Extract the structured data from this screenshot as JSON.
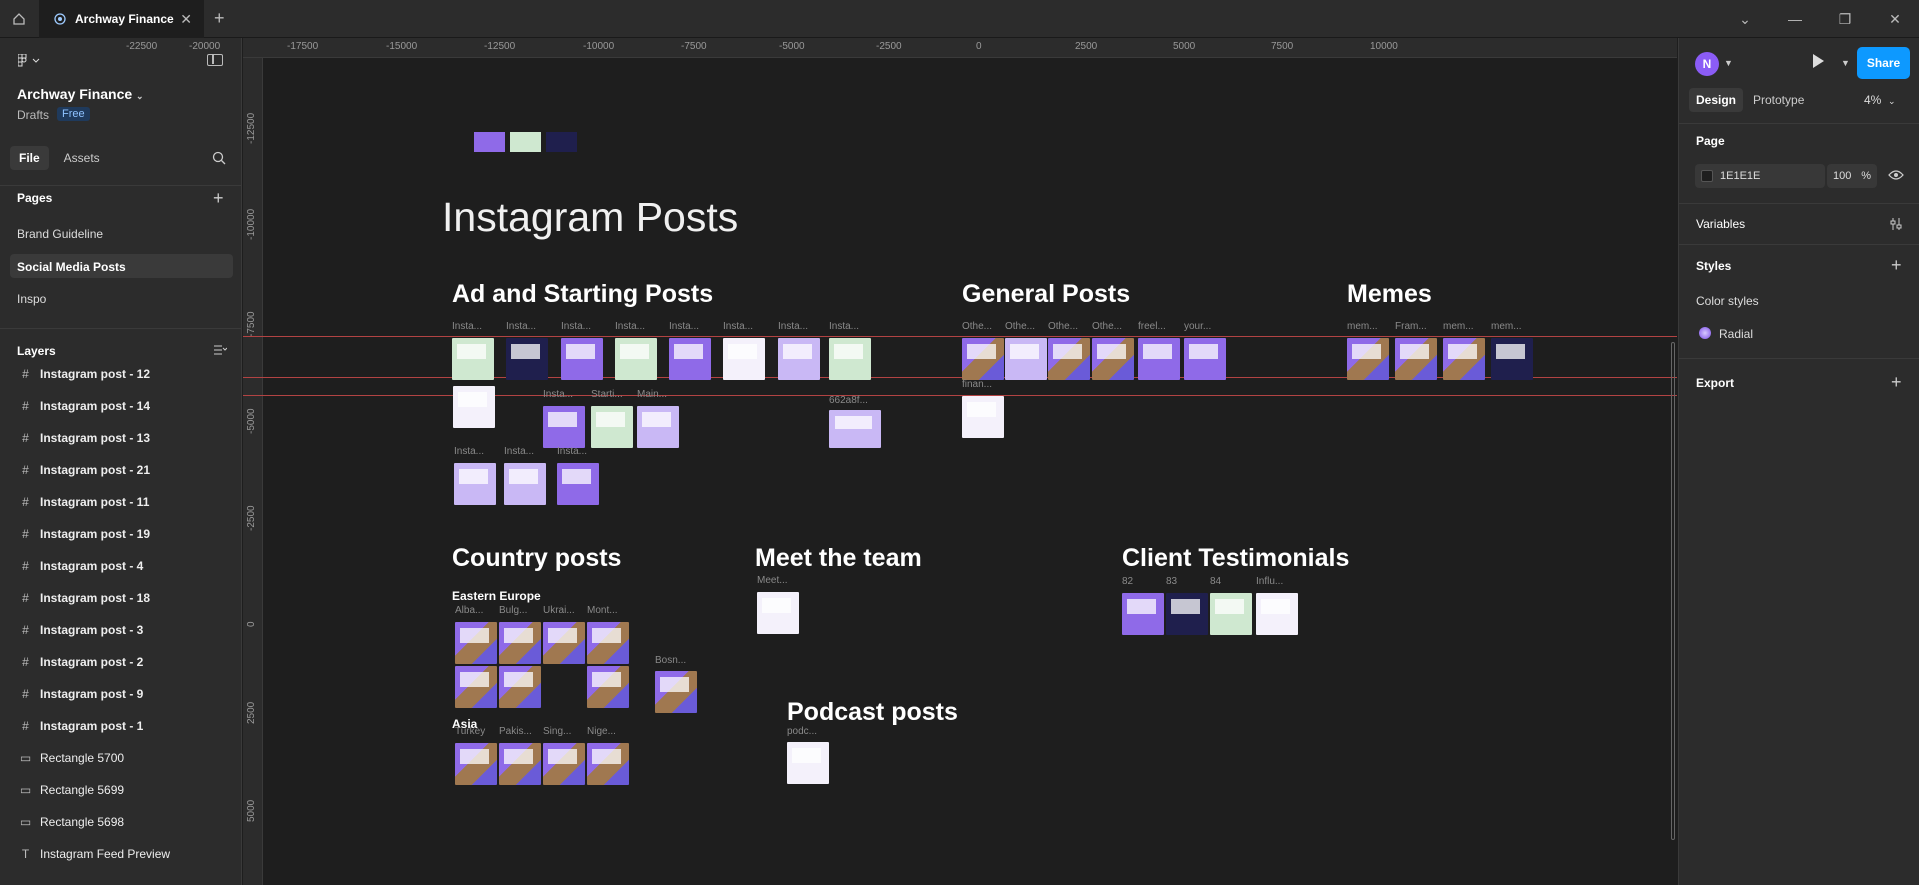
{
  "app": {
    "tab_title": "Archway Finance"
  },
  "ruler": {
    "top": [
      "-22500",
      "-20000",
      "-17500",
      "-15000",
      "-12500",
      "-10000",
      "-7500",
      "-5000",
      "-2500",
      "0",
      "2500",
      "5000",
      "7500",
      "10000"
    ],
    "left": [
      "-12500",
      "-10000",
      "-7500",
      "-5000",
      "-2500",
      "0",
      "2500",
      "5000"
    ]
  },
  "left_panel": {
    "project_name": "Archway Finance",
    "drafts": "Drafts",
    "plan_badge": "Free",
    "tabs": [
      "File",
      "Assets"
    ],
    "pages_heading": "Pages",
    "pages": [
      "Brand Guideline",
      "Social Media Posts",
      "Inspo"
    ],
    "layers_heading": "Layers",
    "layers": [
      "Instagram post - 12",
      "Instagram post - 14",
      "Instagram post - 13",
      "Instagram post - 21",
      "Instagram post - 11",
      "Instagram post - 19",
      "Instagram post - 4",
      "Instagram post - 18",
      "Instagram post - 3",
      "Instagram post - 2",
      "Instagram post - 9",
      "Instagram post - 1",
      "Rectangle 5700",
      "Rectangle 5699",
      "Rectangle 5698",
      "Instagram Feed Preview"
    ]
  },
  "right_panel": {
    "avatar_initial": "N",
    "share_label": "Share",
    "tabs": [
      "Design",
      "Prototype"
    ],
    "zoom": "4%",
    "page_heading": "Page",
    "page_color": "1E1E1E",
    "page_opacity": "100",
    "percent": "%",
    "variables": "Variables",
    "styles": "Styles",
    "color_styles": "Color styles",
    "radial": "Radial",
    "export": "Export"
  },
  "colors": {
    "swatch1": "#8f6ae8",
    "swatch2": "#cfe8d0",
    "swatch3": "#1f1f4d",
    "accent": "#0d99ff"
  },
  "canvas": {
    "title": "Instagram Posts",
    "sections": {
      "ad": "Ad and Starting Posts",
      "general": "General Posts",
      "memes": "Memes",
      "country": "Country posts",
      "meet": "Meet the team",
      "client": "Client Testimonials",
      "podcast": "Podcast posts"
    },
    "eastern_europe": "Eastern Europe",
    "asia": "Asia",
    "ad_labels_row1": [
      "Insta...",
      "Insta...",
      "Insta...",
      "Insta...",
      "Insta...",
      "Insta...",
      "Insta...",
      "Insta..."
    ],
    "ad_labels_row2": [
      "Insta...",
      "Starti...",
      "Main..."
    ],
    "ad_label_extra": "662a8f...",
    "ad_labels_row3": [
      "Insta...",
      "Insta...",
      "Insta..."
    ],
    "general_labels": [
      "Othe...",
      "Othe...",
      "Othe...",
      "Othe...",
      "freel...",
      "your..."
    ],
    "general_label2": "finan...",
    "meme_labels": [
      "mem...",
      "Fram...",
      "mem...",
      "mem..."
    ],
    "ee_labels": [
      "Alba...",
      "Bulg...",
      "Ukrai...",
      "Mont..."
    ],
    "ee_extra": "Bosn...",
    "asia_labels": [
      "Turkey",
      "Pakis...",
      "Sing...",
      "Nige..."
    ],
    "meet_label": "Meet...",
    "client_labels": [
      "82",
      "83",
      "84",
      "Influ..."
    ],
    "podcast_label": "podc..."
  }
}
